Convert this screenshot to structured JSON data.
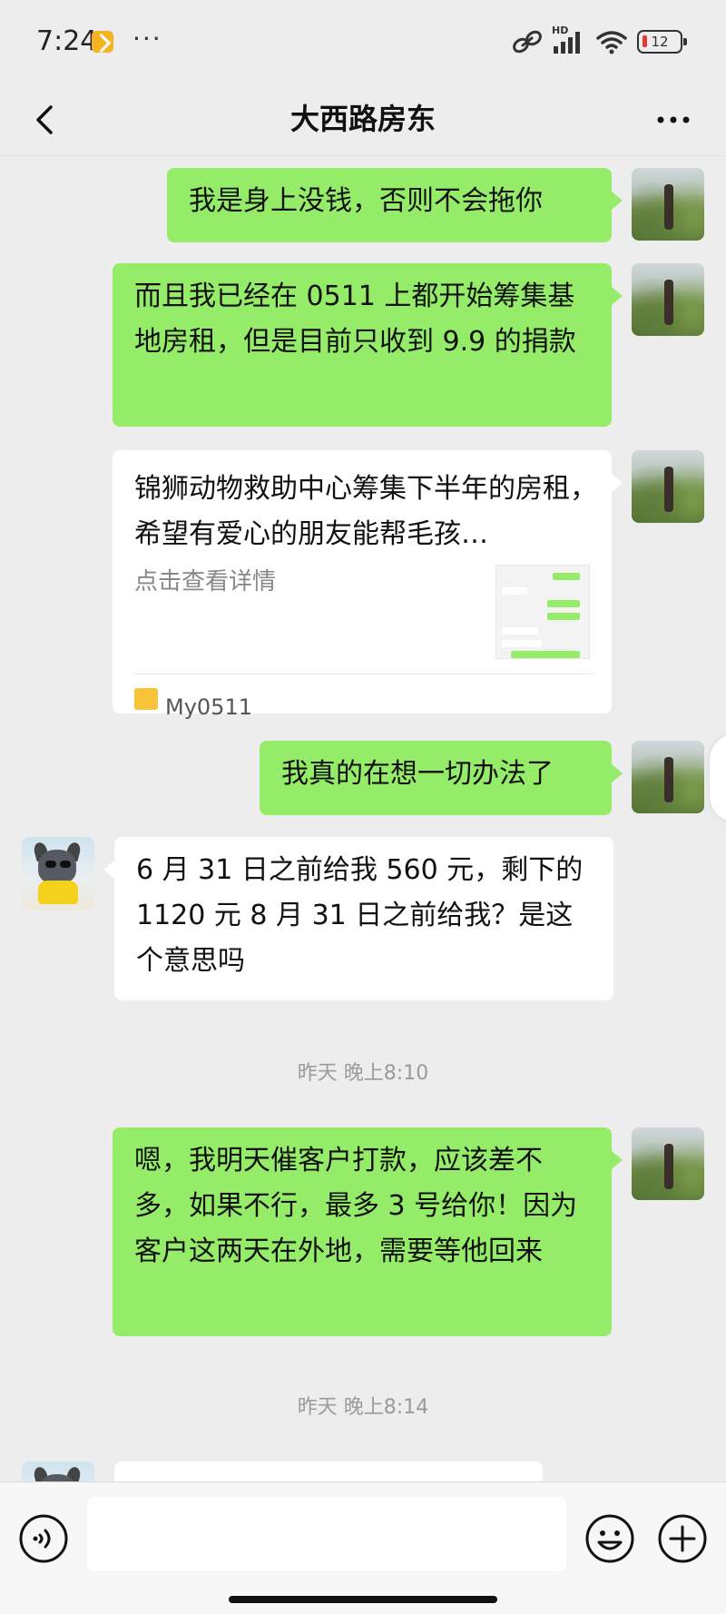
{
  "status_bar": {
    "time": "7:24",
    "dots": "···",
    "network_label": "HD",
    "battery_level": "12"
  },
  "header": {
    "title": "大西路房东"
  },
  "messages": [
    {
      "id": "m1",
      "side": "self",
      "text": "我是身上没钱，否则不会拖你"
    },
    {
      "id": "m2",
      "side": "self",
      "text": "而且我已经在 0511 上都开始筹集基地房租，但是目前只收到 9.9 的捐款"
    },
    {
      "id": "m3",
      "side": "self",
      "type": "card",
      "card": {
        "title": "锦狮动物救助中心筹集下半年的房租，希望有爱心的朋友能帮毛孩…",
        "desc": "点击查看详情",
        "source": "My0511"
      }
    },
    {
      "id": "m4",
      "side": "self",
      "text": "我真的在想一切办法了"
    },
    {
      "id": "m5",
      "side": "other",
      "text": "6 月 31 日之前给我 560 元，剩下的 1120 元 8 月 31 日之前给我？是这个意思吗"
    },
    {
      "id": "m6",
      "side": "self",
      "text": "嗯，我明天催客户打款，应该差不多，如果不行，最多 3 号给你！因为客户这两天在外地，需要等他回来"
    }
  ],
  "timestamps": [
    "昨天 晚上8:10",
    "昨天 晚上8:14"
  ],
  "input_bar": {
    "placeholder": ""
  },
  "icons": {
    "back": "chevron-left-icon",
    "more": "more-horizontal-icon",
    "voice": "voice-icon",
    "emoji": "emoji-icon",
    "plus": "plus-circle-icon"
  },
  "colors": {
    "self_bubble": "#95ec69",
    "other_bubble": "#ffffff",
    "background": "#ededed",
    "battery_low": "#e53935"
  }
}
